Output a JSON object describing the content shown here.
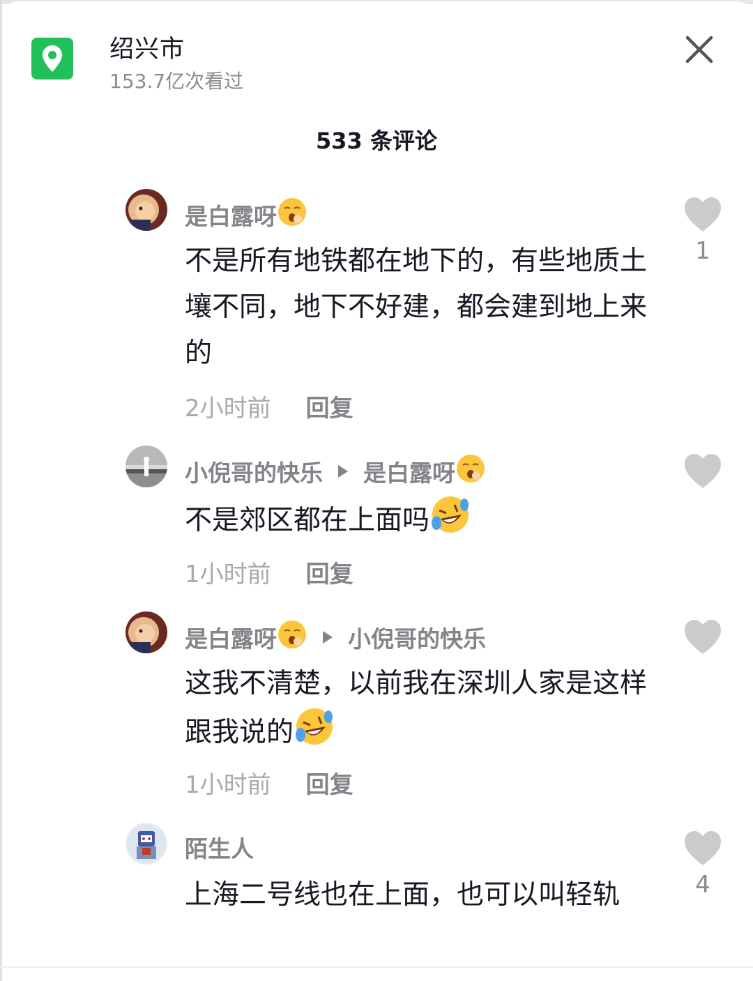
{
  "header": {
    "location_icon": "map-pin-icon",
    "location_title": "绍兴市",
    "view_count": "153.7亿次看过",
    "close_icon": "close-icon"
  },
  "comment_count_label": "533 条评论",
  "comments": [
    {
      "user": "是白露呀",
      "user_emoji": "yawn-emoji",
      "reply_to": "",
      "text": "不是所有地铁都在地下的，有些地质土壤不同，地下不好建，都会建到地上来的",
      "time": "2小时前",
      "reply_label": "回复",
      "likes": "1"
    },
    {
      "user": "小倪哥的快乐",
      "user_emoji": "",
      "reply_to": "是白露呀",
      "text": "不是郊区都在上面吗",
      "text_emoji": "rolling-laugh-emoji",
      "time": "1小时前",
      "reply_label": "回复",
      "likes": ""
    },
    {
      "user": "是白露呀",
      "user_emoji": "yawn-emoji",
      "reply_to": "小倪哥的快乐",
      "text": "这我不清楚，以前我在深圳人家是这样跟我说的",
      "text_emoji": "rolling-laugh-emoji",
      "time": "1小时前",
      "reply_label": "回复",
      "likes": ""
    },
    {
      "user": "陌生人",
      "user_emoji": "",
      "reply_to": "",
      "text": "上海二号线也在上面，也可以叫轻轨",
      "likes": "4"
    }
  ],
  "colors": {
    "location_green": "#22c05a",
    "name_gray": "#838489",
    "time_gray": "#a8a9ae",
    "text_dark": "#161823",
    "heart_gray": "#cbcbcd"
  }
}
